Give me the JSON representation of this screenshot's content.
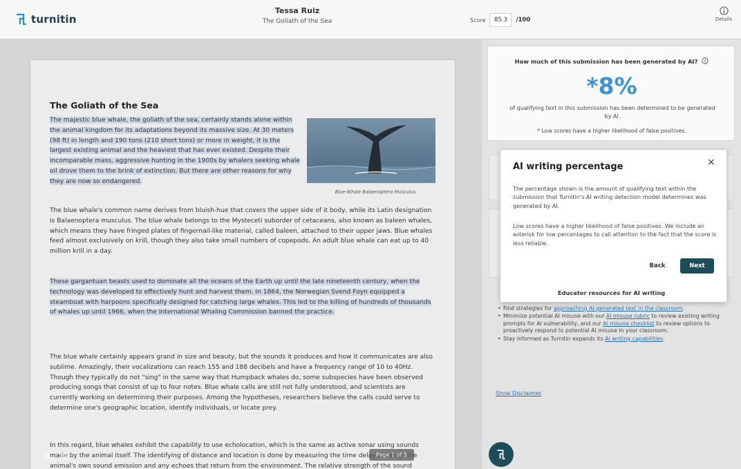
{
  "header": {
    "logo_text": "turnitin",
    "author": "Tessa Ruiz",
    "doc_title": "The Goliath of the Sea",
    "score_label": "Score",
    "score_value": "85.3",
    "score_max": "/100",
    "details_label": "Details"
  },
  "document": {
    "heading": "The Goliath of the Sea",
    "para1": "The majestic blue whale, the goliath of the sea, certainly stands alone within the animal kingdom for its adaptations beyond its massive size. At 30 meters (98 ft) in length and 190 tons (210 short tons) or more in weight, it is the largest existing animal and the heaviest that has ever existed. Despite their incomparable mass, aggressive hunting in the 1900s by whalers seeking whale oil drove them to the brink of extinction. But there are other reasons for why they are now so endangered.",
    "image_caption": "Blue-Whale Balaenoptera Musculus",
    "para2": "The blue whale's common name derives from bluish-hue that covers the upper side of it body, while its Latin designation is Balaenoptera musculus. The blue whale belongs to the Mysteceti suborder of cetaceans, also known as baleen whales, which means they have fringed plates of fingernail-like material, called baleen, attached to their upper jaws. Blue whales feed almost exclusively on krill, though they also take small numbers of copepods. An adult blue whale can eat up to 40 million krill in a day.",
    "para3": "These gargantuan beasts used to dominate all the oceans of the Earth up until the late nineteenth century, when the technology was developed to effectively hunt and harvest them. In 1864, the Norwegian Svend Foyn equipped a steamboat with harpoons specifically designed for catching large whales. This led to the killing of hundreds of thousands of whales up until 1966, when the International Whaling Commission banned the practice.",
    "para4": "The blue whale certainly appears grand in size and beauty, but the sounds it produces and how it communicates are also sublime. Amazingly, their vocalizations can reach 155 and 188 decibels and have a frequency range of 10 to 40Hz. Though they typically do not \"sing\" in the same way that Humpback whales do, some subspecies have been observed producing songs that consist of up to four notes. Blue whale calls are still not fully understood, and scientists are currently working on determining their purposes. Among the hypotheses, researchers believe the calls could serve to determine one's geographic location, identify individuals, or locate prey.",
    "para5": "In this regard, blue whales exhibit the capability to use echolocation, which is the same as active sonar using sounds made by the animal itself. The identifying of distance and location is done by measuring the time delay between the animal's own sound emission and any echoes that return from the environment. The relative strength of the sound received at each ear as well as the time delay between arrival at the two ears provide information about the horizontal angle from which",
    "page_indicator": "Page 1 of 5"
  },
  "ai_panel": {
    "question": "How much of this submission has been generated by AI?",
    "percentage": "*8%",
    "description": "of qualifying text in this submission has been determined to be generated by AI.",
    "note": "* Low scores have a higher likelihood of false positives."
  },
  "popover": {
    "title": "AI writing percentage",
    "close": "×",
    "para1": "The percentage shown is the amount of qualifying text within the submission that Turnitin's AI writing detection model determines was generated by AI.",
    "para2": "Low scores have a higher likelihood of false positives. We include an asterisk for low percentages to call attention to the fact that the score is less reliable.",
    "back": "Back",
    "next": "Next"
  },
  "resources": {
    "title": "Educator resources for AI writing",
    "item1_pre": "Find strategies for ",
    "item1_link": "approaching AI-generated text in the classroom",
    "item1_post": ".",
    "item2_pre": "Minimize potential AI misuse with our ",
    "item2_link1": "AI misuse rubric",
    "item2_mid": " to review existing writing prompts for AI vulnerability, and our ",
    "item2_link2": "AI misuse checklist",
    "item2_post": " to review options to proactively respond to potential AI misuse in your classroom.",
    "item3_pre": "Stay informed as Turnitin expands its ",
    "item3_link": "AI writing capabilities",
    "item3_post": ".",
    "disclaimer": "Show Disclaimer"
  },
  "colors": {
    "accent": "#3d93d4",
    "brand_dark": "#1e4d5a",
    "highlight": "#cfd8e6",
    "link": "#2b6cb0"
  }
}
